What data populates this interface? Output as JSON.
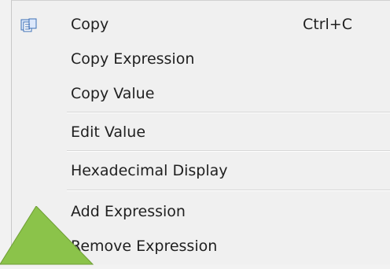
{
  "menu": {
    "items": [
      {
        "label": "Copy",
        "shortcut": "Ctrl+C",
        "icon": "copy-icon"
      },
      {
        "label": "Copy Expression"
      },
      {
        "label": "Copy Value"
      },
      {
        "label": "Edit Value"
      },
      {
        "label": "Hexadecimal Display"
      },
      {
        "label": "Add Expression"
      },
      {
        "label": "Remove Expression"
      }
    ]
  },
  "colors": {
    "menu_background": "#f0f0f0",
    "text": "#1f1f1f",
    "separator": "#d7d7d7",
    "copy_icon_blue": "#3d6fb6",
    "pointer_green": "#8bc34a"
  }
}
